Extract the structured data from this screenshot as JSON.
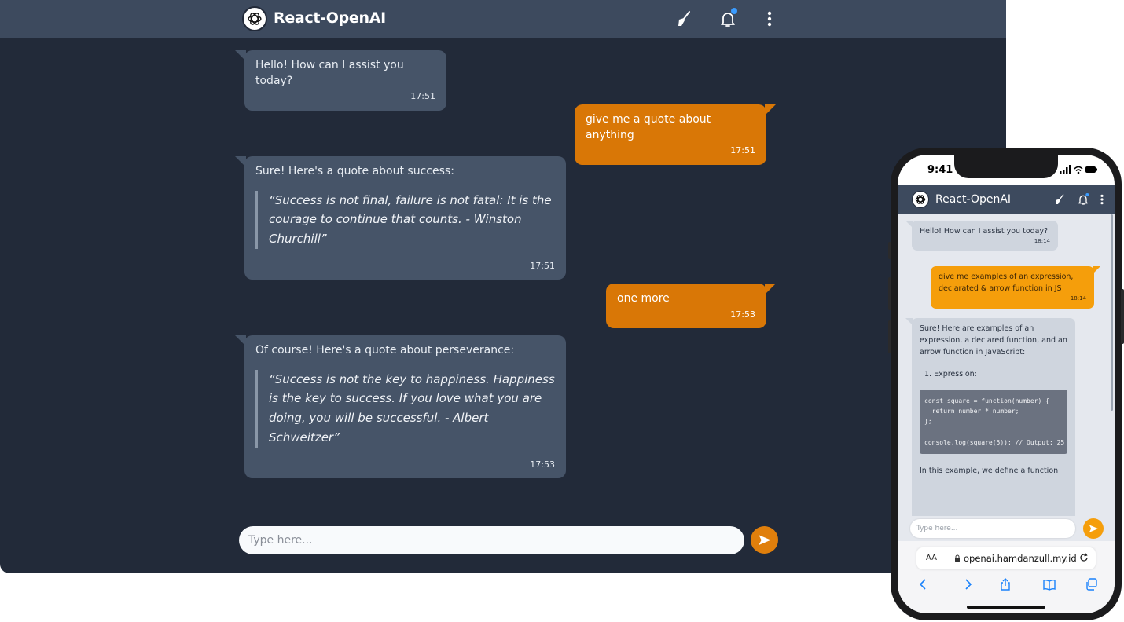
{
  "app": {
    "title": "React-OpenAI"
  },
  "desktop": {
    "messages": [
      {
        "role": "bot",
        "text": "Hello! How can I assist you today?",
        "time": "17:51"
      },
      {
        "role": "user",
        "text": "give me a quote about anything",
        "time": "17:51"
      },
      {
        "role": "bot",
        "text": "Sure! Here's a quote about success:",
        "quote": "“Success is not final, failure is not fatal: It is the courage to continue that counts. - Winston Churchill”",
        "time": "17:51"
      },
      {
        "role": "user",
        "text": "one more",
        "time": "17:53"
      },
      {
        "role": "bot",
        "text": "Of course! Here's a quote about perseverance:",
        "quote": "“Success is not the key to happiness. Happiness is the key to success. If you love what you are doing, you will be successful. - Albert Schweitzer”",
        "time": "17:53"
      }
    ],
    "input_placeholder": "Type here..."
  },
  "phone": {
    "status_time": "9:41",
    "messages": [
      {
        "role": "bot",
        "text": "Hello! How can I assist you today?",
        "time": "18:14"
      },
      {
        "role": "user",
        "text": "give me examples of an expression, declarated & arrow function in JS",
        "time": "18:14"
      },
      {
        "role": "bot",
        "text": "Sure! Here are examples of an expression, a declared function, and an arrow function in JavaScript:",
        "list_item": "1.  Expression:",
        "code": "const square = function(number) {\n  return number * number;\n};\n\nconsole.log(square(5)); // Output: 25",
        "after": "In this example, we define a function"
      }
    ],
    "input_placeholder": "Type here...",
    "safari": {
      "text_size": "AA",
      "url": "openai.hamdanzull.my.id"
    }
  },
  "colors": {
    "accent": "#d97706",
    "header": "#3d4a5e",
    "background": "#222a39",
    "bot_bubble": "#465468"
  },
  "icons": [
    "openai-logo-icon",
    "broom-icon",
    "bell-icon",
    "more-vertical-icon",
    "send-icon",
    "lock-icon",
    "reload-icon",
    "back-icon",
    "forward-icon",
    "share-icon",
    "bookmarks-icon",
    "tabs-icon"
  ]
}
